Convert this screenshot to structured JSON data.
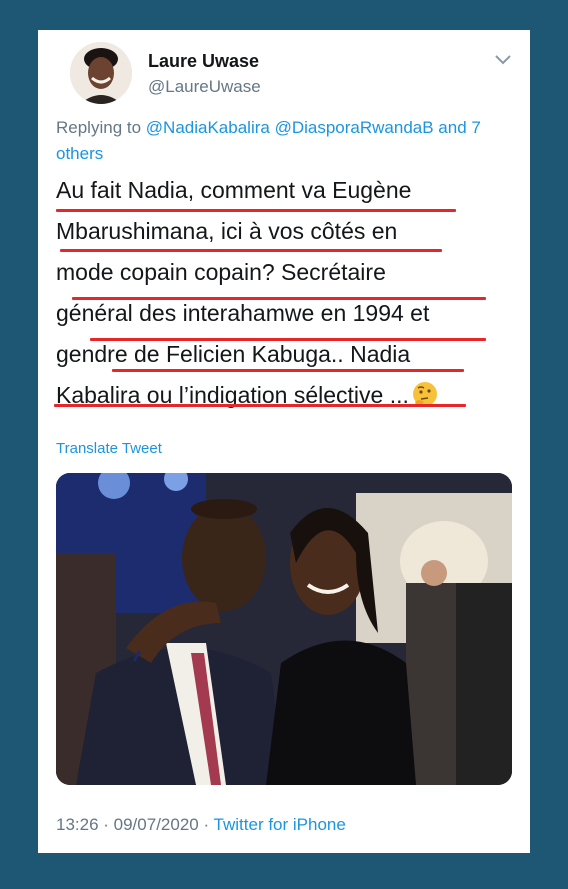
{
  "tweet": {
    "display_name": "Laure Uwase",
    "handle": "@LaureUwase",
    "replying_prefix": "Replying to",
    "replying_to": "@NadiaKabalira @DiasporaRwandaB and 7 others",
    "lines": [
      "Au fait Nadia, comment va Eugène",
      "Mbarushimana, ici à vos côtés en",
      "mode copain copain? Secrétaire",
      "général des interahamwe en 1994 et",
      "gendre de Felicien Kabuga.. Nadia",
      "Kabalira ou l’indigation sélective ..."
    ],
    "emoji_icon": "thinking-face-icon",
    "translate_label": "Translate Tweet",
    "timestamp": "13:26 · 09/07/2020 ·",
    "source": "Twitter for iPhone"
  },
  "colors": {
    "background": "#1e5773",
    "link": "#1b95e0",
    "secondary_text": "#657786",
    "underline_markup": "#e8262a"
  }
}
